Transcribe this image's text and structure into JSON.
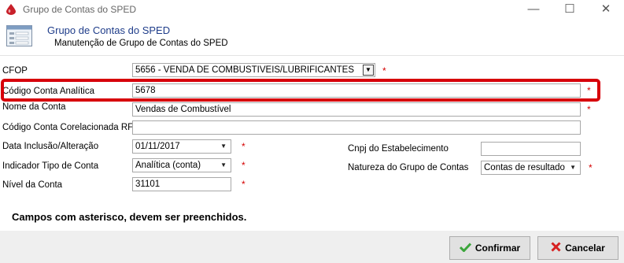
{
  "window": {
    "title": "Grupo de Contas do SPED",
    "minimize": "—",
    "maximize": "☐",
    "close": "✕"
  },
  "header": {
    "title": "Grupo de Contas do SPED",
    "subtitle": "Manutenção de Grupo de Contas do SPED"
  },
  "form": {
    "cfop": {
      "label": "CFOP",
      "value": "5656  - VENDA DE COMBUSTIVEIS/LUBRIFICANTES",
      "button": "▼",
      "required": "*"
    },
    "codigo_conta": {
      "label": "Código Conta Analítica",
      "value": "5678",
      "required": "*"
    },
    "nome_conta": {
      "label": "Nome da Conta",
      "value": "Vendas de Combustível",
      "required": "*"
    },
    "codigo_rfb": {
      "label": "Código Conta Corelacionada RFB",
      "value": ""
    },
    "data_inclusao": {
      "label": "Data Inclusão/Alteração",
      "value": "01/11/2017",
      "arrow": "▼",
      "required": "*"
    },
    "indicador_tipo": {
      "label": "Indicador Tipo de Conta",
      "value": "Analítica (conta)",
      "arrow": "▼",
      "required": "*"
    },
    "nivel": {
      "label": "Nível da Conta",
      "value": "31101",
      "required": "*"
    },
    "cnpj": {
      "label": "Cnpj do Estabelecimento",
      "value": ""
    },
    "natureza": {
      "label": "Natureza do Grupo de Contas",
      "value": "Contas de resultado",
      "arrow": "▼",
      "required": "*"
    }
  },
  "note": "Campos com asterisco, devem ser preenchidos.",
  "buttons": {
    "confirm": "Confirmar",
    "cancel": "Cancelar"
  },
  "colors": {
    "highlight": "#d7000a",
    "required": "#d40000",
    "header_title": "#1f3d8a",
    "confirm_icon": "#3aa53a",
    "cancel_icon": "#d62020"
  }
}
